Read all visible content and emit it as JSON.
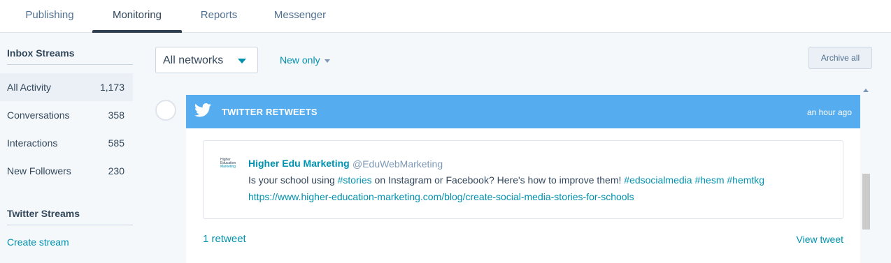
{
  "tabs": [
    {
      "label": "Publishing"
    },
    {
      "label": "Monitoring",
      "active": true
    },
    {
      "label": "Reports"
    },
    {
      "label": "Messenger"
    }
  ],
  "sidebar": {
    "inbox_heading": "Inbox Streams",
    "streams": [
      {
        "label": "All Activity",
        "count": "1,173",
        "active": true
      },
      {
        "label": "Conversations",
        "count": "358"
      },
      {
        "label": "Interactions",
        "count": "585"
      },
      {
        "label": "New Followers",
        "count": "230"
      }
    ],
    "twitter_heading": "Twitter Streams",
    "create_stream": "Create stream"
  },
  "toolbar": {
    "network_select": "All networks",
    "filter": "New only",
    "archive_button": "Archive all"
  },
  "card": {
    "icon": "twitter-bird-icon",
    "title": "TWITTER RETWEETS",
    "time": "an hour ago",
    "header_color": "#55acee",
    "tweet": {
      "avatar_text_1": "Higher",
      "avatar_text_2": "Education",
      "avatar_text_3": "Marketing",
      "author": "Higher Edu Marketing",
      "handle": "@EduWebMarketing",
      "text_prefix": "Is your school using ",
      "hashtag_stories": "#stories",
      "text_middle": " on Instagram or Facebook? Here's how to improve them! ",
      "hashtag_1": "#edsocialmedia",
      "hashtag_2": "#hesm",
      "hashtag_3": "#hemtkg",
      "link": "https://www.higher-education-marketing.com/blog/create-social-media-stories-for-schools"
    },
    "retweet_count": "1 retweet",
    "view_tweet": "View tweet"
  }
}
